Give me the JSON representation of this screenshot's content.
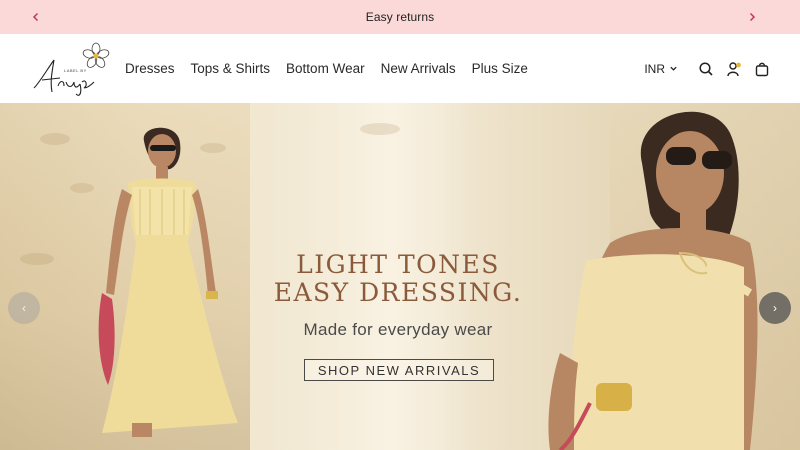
{
  "announcement": {
    "text": "Easy returns",
    "prev_icon": "chevron-left-icon",
    "next_icon": "chevron-right-icon",
    "background": "#fbd9d9",
    "arrow_color": "#c0395b"
  },
  "header": {
    "logo": {
      "script_text": "Anuja",
      "small_text": "LABEL BY"
    },
    "nav": [
      {
        "label": "Dresses"
      },
      {
        "label": "Tops & Shirts"
      },
      {
        "label": "Bottom Wear"
      },
      {
        "label": "New Arrivals"
      },
      {
        "label": "Plus Size"
      }
    ],
    "currency": "INR",
    "icons": [
      "search-icon",
      "account-icon",
      "bag-icon"
    ]
  },
  "hero": {
    "headline_line1": "LIGHT TONES",
    "headline_line2": "EASY DRESSING.",
    "subheading": "Made for everyday wear",
    "cta_label": "SHOP NEW ARRIVALS",
    "prev_arrow": "‹",
    "next_arrow": "›",
    "headline_color": "#8a5a3b"
  }
}
